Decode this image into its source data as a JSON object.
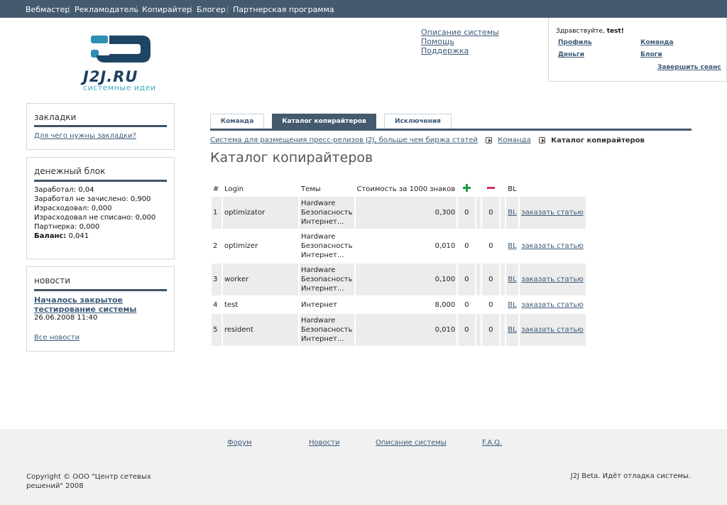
{
  "topnav": {
    "items": [
      "Вебмастер",
      "Рекламодатель",
      "Копирайтер",
      "Блогер",
      "Партнерская программа"
    ]
  },
  "logo": {
    "brand": "J2J.RU",
    "slogan": "системные идеи"
  },
  "header_links": {
    "description": "Описание системы",
    "help": "Помощь",
    "support": "Поддержка"
  },
  "userbox": {
    "greeting": "Здравствуйте,",
    "username": "test!",
    "profile": "Профиль",
    "team": "Команда",
    "money": "Деньги",
    "blogs": "Блоги",
    "logout": "Завершить сеанс"
  },
  "bookmarks": {
    "title": "закладки",
    "link": "Для чего нужны закладки?"
  },
  "money_block": {
    "title": "денежный блок",
    "lines": [
      "Заработал: 0,04",
      "Заработал не зачислено: 0,900",
      "Израсходовал: 0,000",
      "Израсходовал не списано: 0,000",
      "Партнерка: 0,000"
    ],
    "balance_label": "Баланс:",
    "balance_value": "0,041"
  },
  "news": {
    "title": "новости",
    "headline": "Началось закрытое тестирование системы",
    "date": "26.06.2008 11:40",
    "all_link": "Все новости"
  },
  "tabs": [
    "Команда",
    "Каталог копирайтеров",
    "Исключения"
  ],
  "active_tab": 1,
  "breadcrumbs": {
    "root": "Система для размещения пресс-релизов J2J, больше чем биржа статей",
    "team": "Команда",
    "current": "Каталог копирайтеров"
  },
  "page_title": "Каталог копирайтеров",
  "table": {
    "headers": {
      "num": "#",
      "login": "Login",
      "topics": "Темы",
      "price": "Стоимость за 1000 знаков",
      "bl": "BL"
    },
    "rows": [
      {
        "num": "1",
        "login": "optimizator",
        "topics": [
          "Hardware",
          "Безопасность",
          "Интернет..."
        ],
        "price": "0,300",
        "plus": "0",
        "minus": "0",
        "bl": "BL",
        "order": "заказать статью",
        "shaded": true
      },
      {
        "num": "2",
        "login": "optimizer",
        "topics": [
          "Hardware",
          "Безопасность",
          "Интернет..."
        ],
        "price": "0,010",
        "plus": "0",
        "minus": "0",
        "bl": "BL",
        "order": "заказать статью",
        "shaded": false
      },
      {
        "num": "3",
        "login": "worker",
        "topics": [
          "Hardware",
          "Безопасность",
          "Интернет..."
        ],
        "price": "0,100",
        "plus": "0",
        "minus": "0",
        "bl": "BL",
        "order": "заказать статью",
        "shaded": true
      },
      {
        "num": "4",
        "login": "test",
        "topics": [
          "Интернет"
        ],
        "price": "8,000",
        "plus": "0",
        "minus": "0",
        "bl": "BL",
        "order": "заказать статью",
        "shaded": false
      },
      {
        "num": "5",
        "login": "resident",
        "topics": [
          "Hardware",
          "Безопасность",
          "Интернет..."
        ],
        "price": "0,010",
        "plus": "0",
        "minus": "0",
        "bl": "BL",
        "order": "заказать статью",
        "shaded": true
      }
    ]
  },
  "footer": {
    "links": [
      "Форум",
      "Новости",
      "Описание системы",
      "F.A.Q."
    ],
    "copyright": "Copyright © ООО \"Центр сетевых решений\" 2008",
    "beta": "J2J Beta. Идёт отладка системы."
  },
  "colors": {
    "nav_bg": "#445a6e",
    "link": "#3d5a78",
    "plus": "#1a9a4a",
    "minus": "#d0335a"
  }
}
